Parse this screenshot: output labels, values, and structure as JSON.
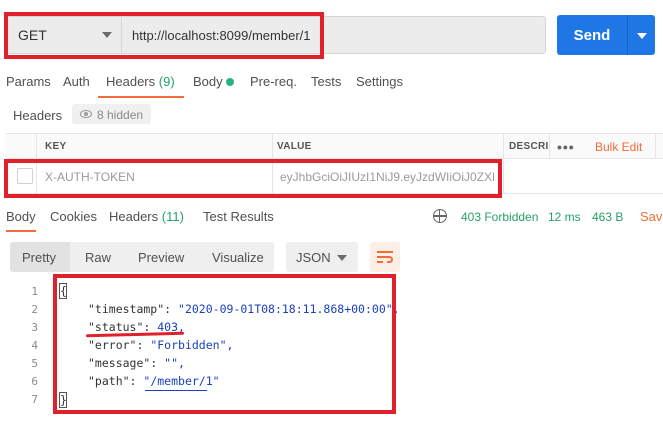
{
  "request": {
    "method": "GET",
    "url": "http://localhost:8099/member/1",
    "send_label": "Send"
  },
  "request_tabs": {
    "params": "Params",
    "auth": "Auth",
    "headers": "Headers",
    "headers_count": "(9)",
    "body": "Body",
    "prereq": "Pre-req.",
    "tests": "Tests",
    "settings": "Settings"
  },
  "headers_section": {
    "label": "Headers",
    "hidden": "8 hidden"
  },
  "header_table": {
    "col_key": "KEY",
    "col_value": "VALUE",
    "col_desc": "DESCRI",
    "more": "•••",
    "bulk_edit": "Bulk Edit",
    "rows": [
      {
        "key": "X-AUTH-TOKEN",
        "value": "eyJhbGciOiJIUzI1NiJ9.eyJzdWIiOiJ0ZXN"
      }
    ]
  },
  "response_tabs": {
    "body": "Body",
    "cookies": "Cookies",
    "headers": "Headers",
    "headers_count": "(11)",
    "test_results": "Test Results"
  },
  "response_meta": {
    "status": "403 Forbidden",
    "time": "12 ms",
    "size": "463 B",
    "save": "Save"
  },
  "response_view": {
    "pretty": "Pretty",
    "raw": "Raw",
    "preview": "Preview",
    "visualize": "Visualize",
    "format": "JSON"
  },
  "response_body": {
    "line_numbers": [
      "1",
      "2",
      "3",
      "4",
      "5",
      "6",
      "7"
    ],
    "open_brace": "{",
    "close_brace": "}",
    "fields": [
      {
        "key": "\"timestamp\"",
        "value": "\"2020-09-01T08:18:11.868+00:00\","
      },
      {
        "key": "\"status\"",
        "value": "403,"
      },
      {
        "key": "\"error\"",
        "value": "\"Forbidden\","
      },
      {
        "key": "\"message\"",
        "value": "\"\","
      },
      {
        "key": "\"path\"",
        "value": "\"/member/1\""
      }
    ]
  },
  "colors": {
    "accent": "#f26b3a",
    "send": "#1f77e6",
    "success": "#26a06a",
    "annotation": "#e0202a"
  }
}
